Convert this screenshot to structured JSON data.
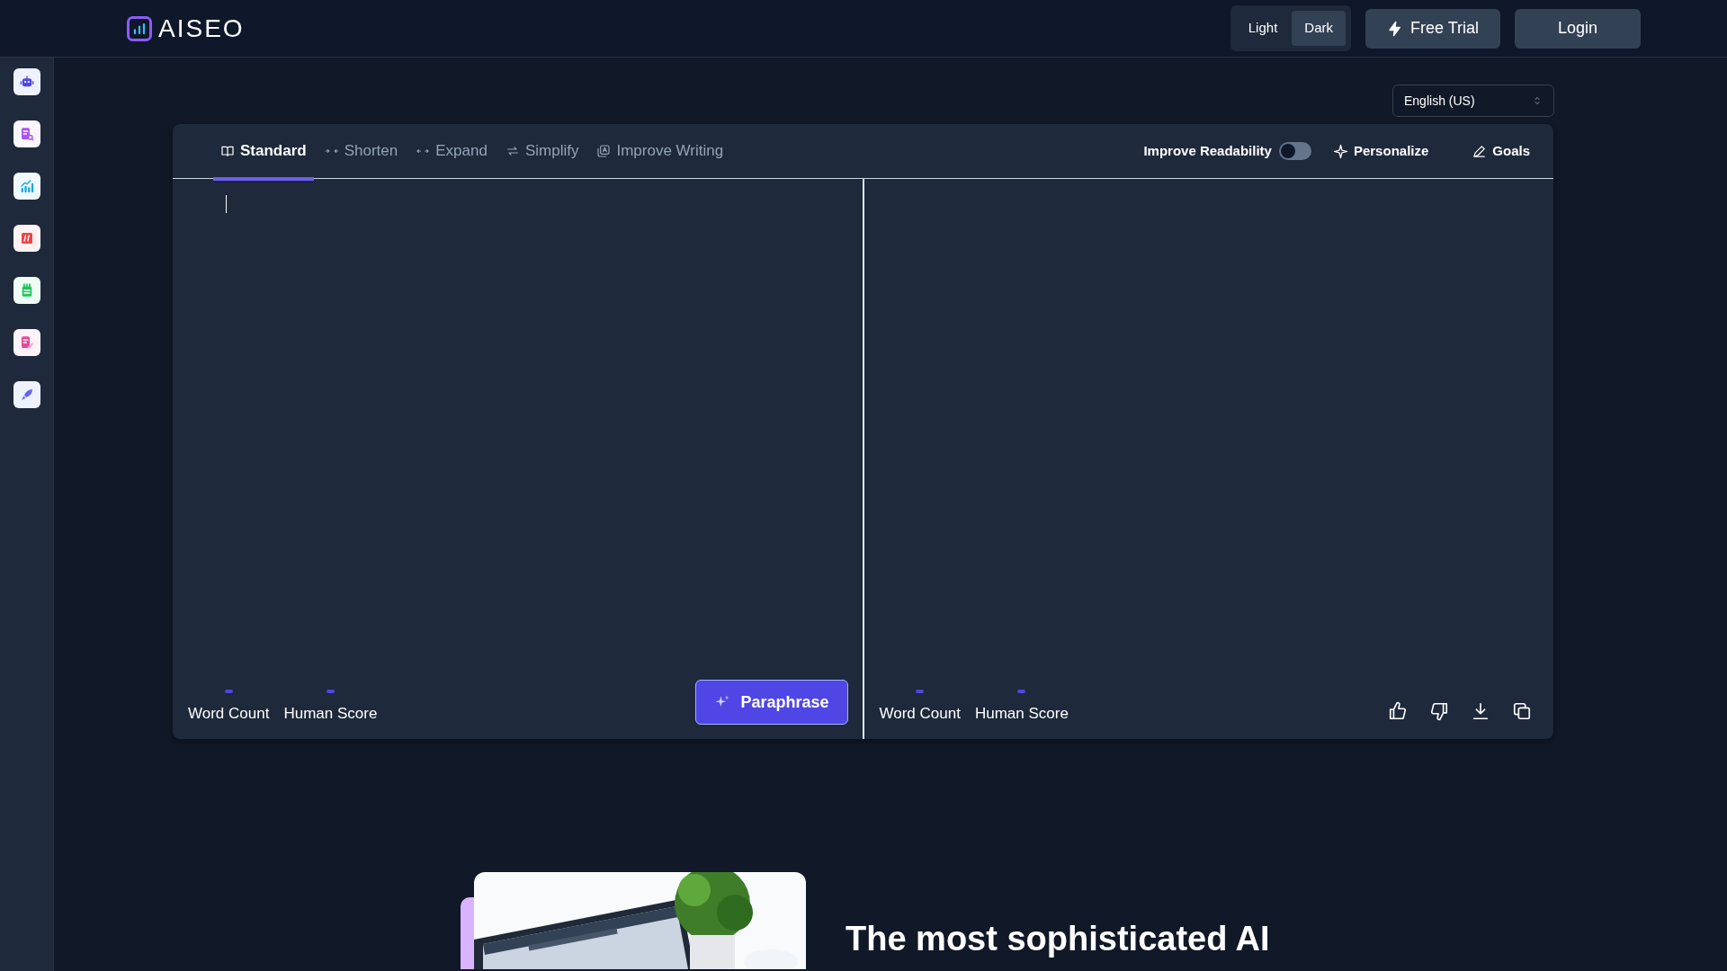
{
  "header": {
    "logo": "AISEO",
    "theme_options": [
      {
        "label": "Light",
        "selected": false
      },
      {
        "label": "Dark",
        "selected": true
      }
    ],
    "free_trial": "Free Trial",
    "login": "Login"
  },
  "language": "English (US)",
  "tabs": [
    {
      "label": "Standard",
      "selected": true
    },
    {
      "label": "Shorten",
      "selected": false
    },
    {
      "label": "Expand",
      "selected": false
    },
    {
      "label": "Simplify",
      "selected": false
    },
    {
      "label": "Improve Writing",
      "selected": false
    }
  ],
  "toolbar": {
    "readability_label": "Improve Readability",
    "readability_on": false,
    "personalize": "Personalize",
    "goals": "Goals"
  },
  "input_panel": {
    "word_count": "Word Count",
    "human_score": "Human Score",
    "paraphrase": "Paraphrase"
  },
  "output_panel": {
    "word_count": "Word Count",
    "human_score": "Human Score"
  },
  "promo": {
    "heading": "The most sophisticated AI"
  }
}
